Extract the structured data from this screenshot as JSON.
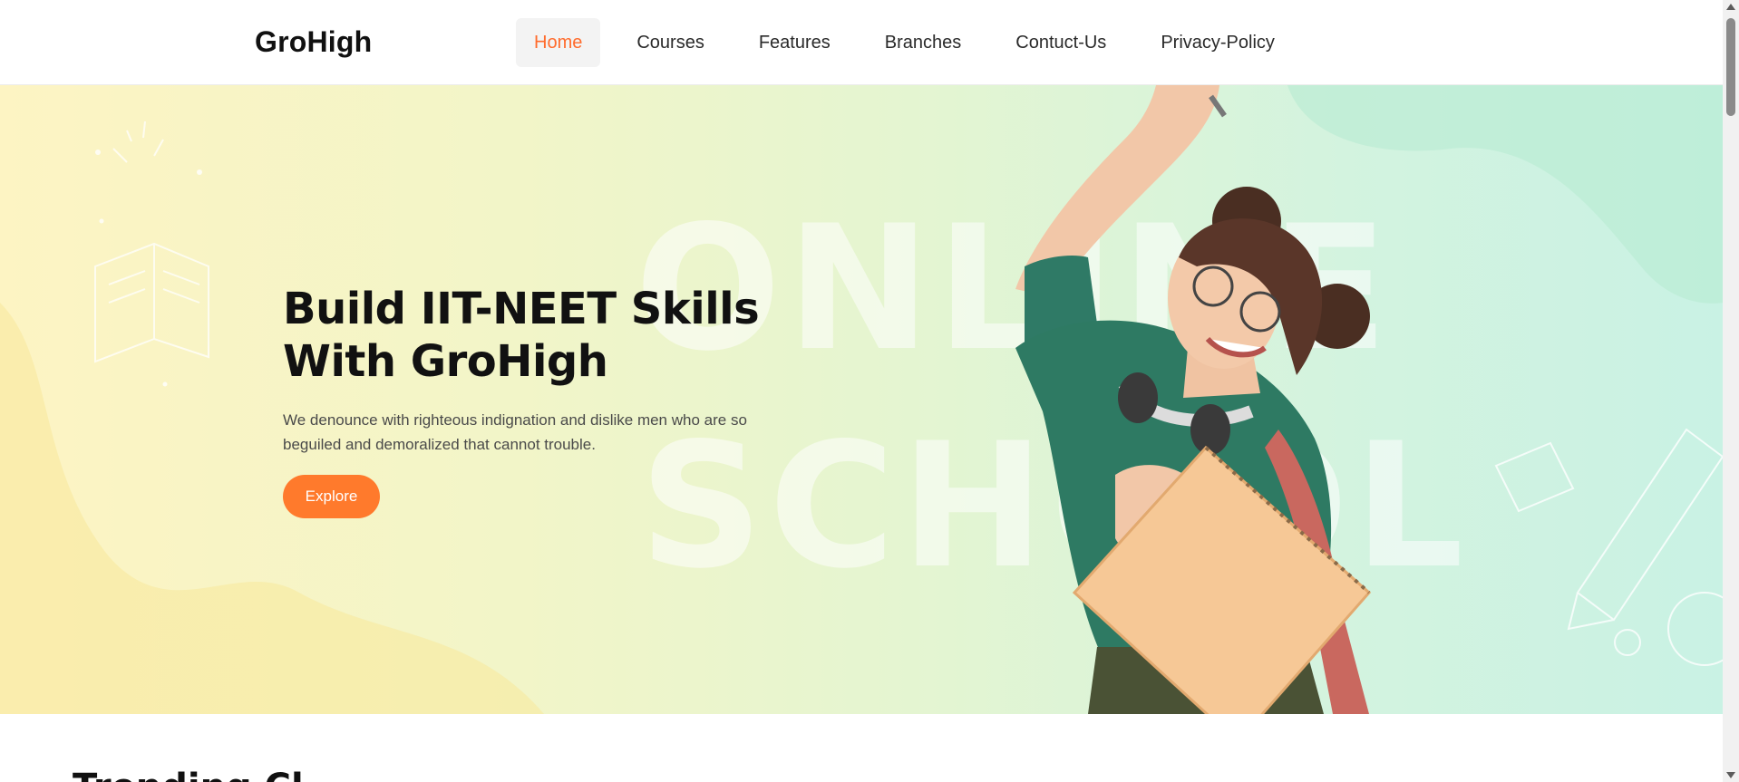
{
  "header": {
    "logo": "GroHigh",
    "nav": [
      {
        "label": "Home",
        "active": true
      },
      {
        "label": "Courses",
        "active": false
      },
      {
        "label": "Features",
        "active": false
      },
      {
        "label": "Branches",
        "active": false
      },
      {
        "label": "Contuct-Us",
        "active": false
      },
      {
        "label": "Privacy-Policy",
        "active": false
      }
    ]
  },
  "hero": {
    "title_line1": "Build IIT-NEET Skills",
    "title_line2": "With GroHigh",
    "description": "We denounce with righteous indignation and dislike men who are so beguiled and demoralized that cannot trouble.",
    "cta_label": "Explore",
    "background_word_1": "ONLINE",
    "background_word_2": "SCHOOL",
    "illustration": "student-with-notebook-illustration"
  },
  "next_section": {
    "heading": "Trending Cl"
  },
  "colors": {
    "accent": "#ff7a2c",
    "active_nav_text": "#ff6b2c",
    "active_nav_bg": "#f3f3f3",
    "hero_left": "#fdf4c3",
    "hero_right": "#c9f2e4"
  }
}
